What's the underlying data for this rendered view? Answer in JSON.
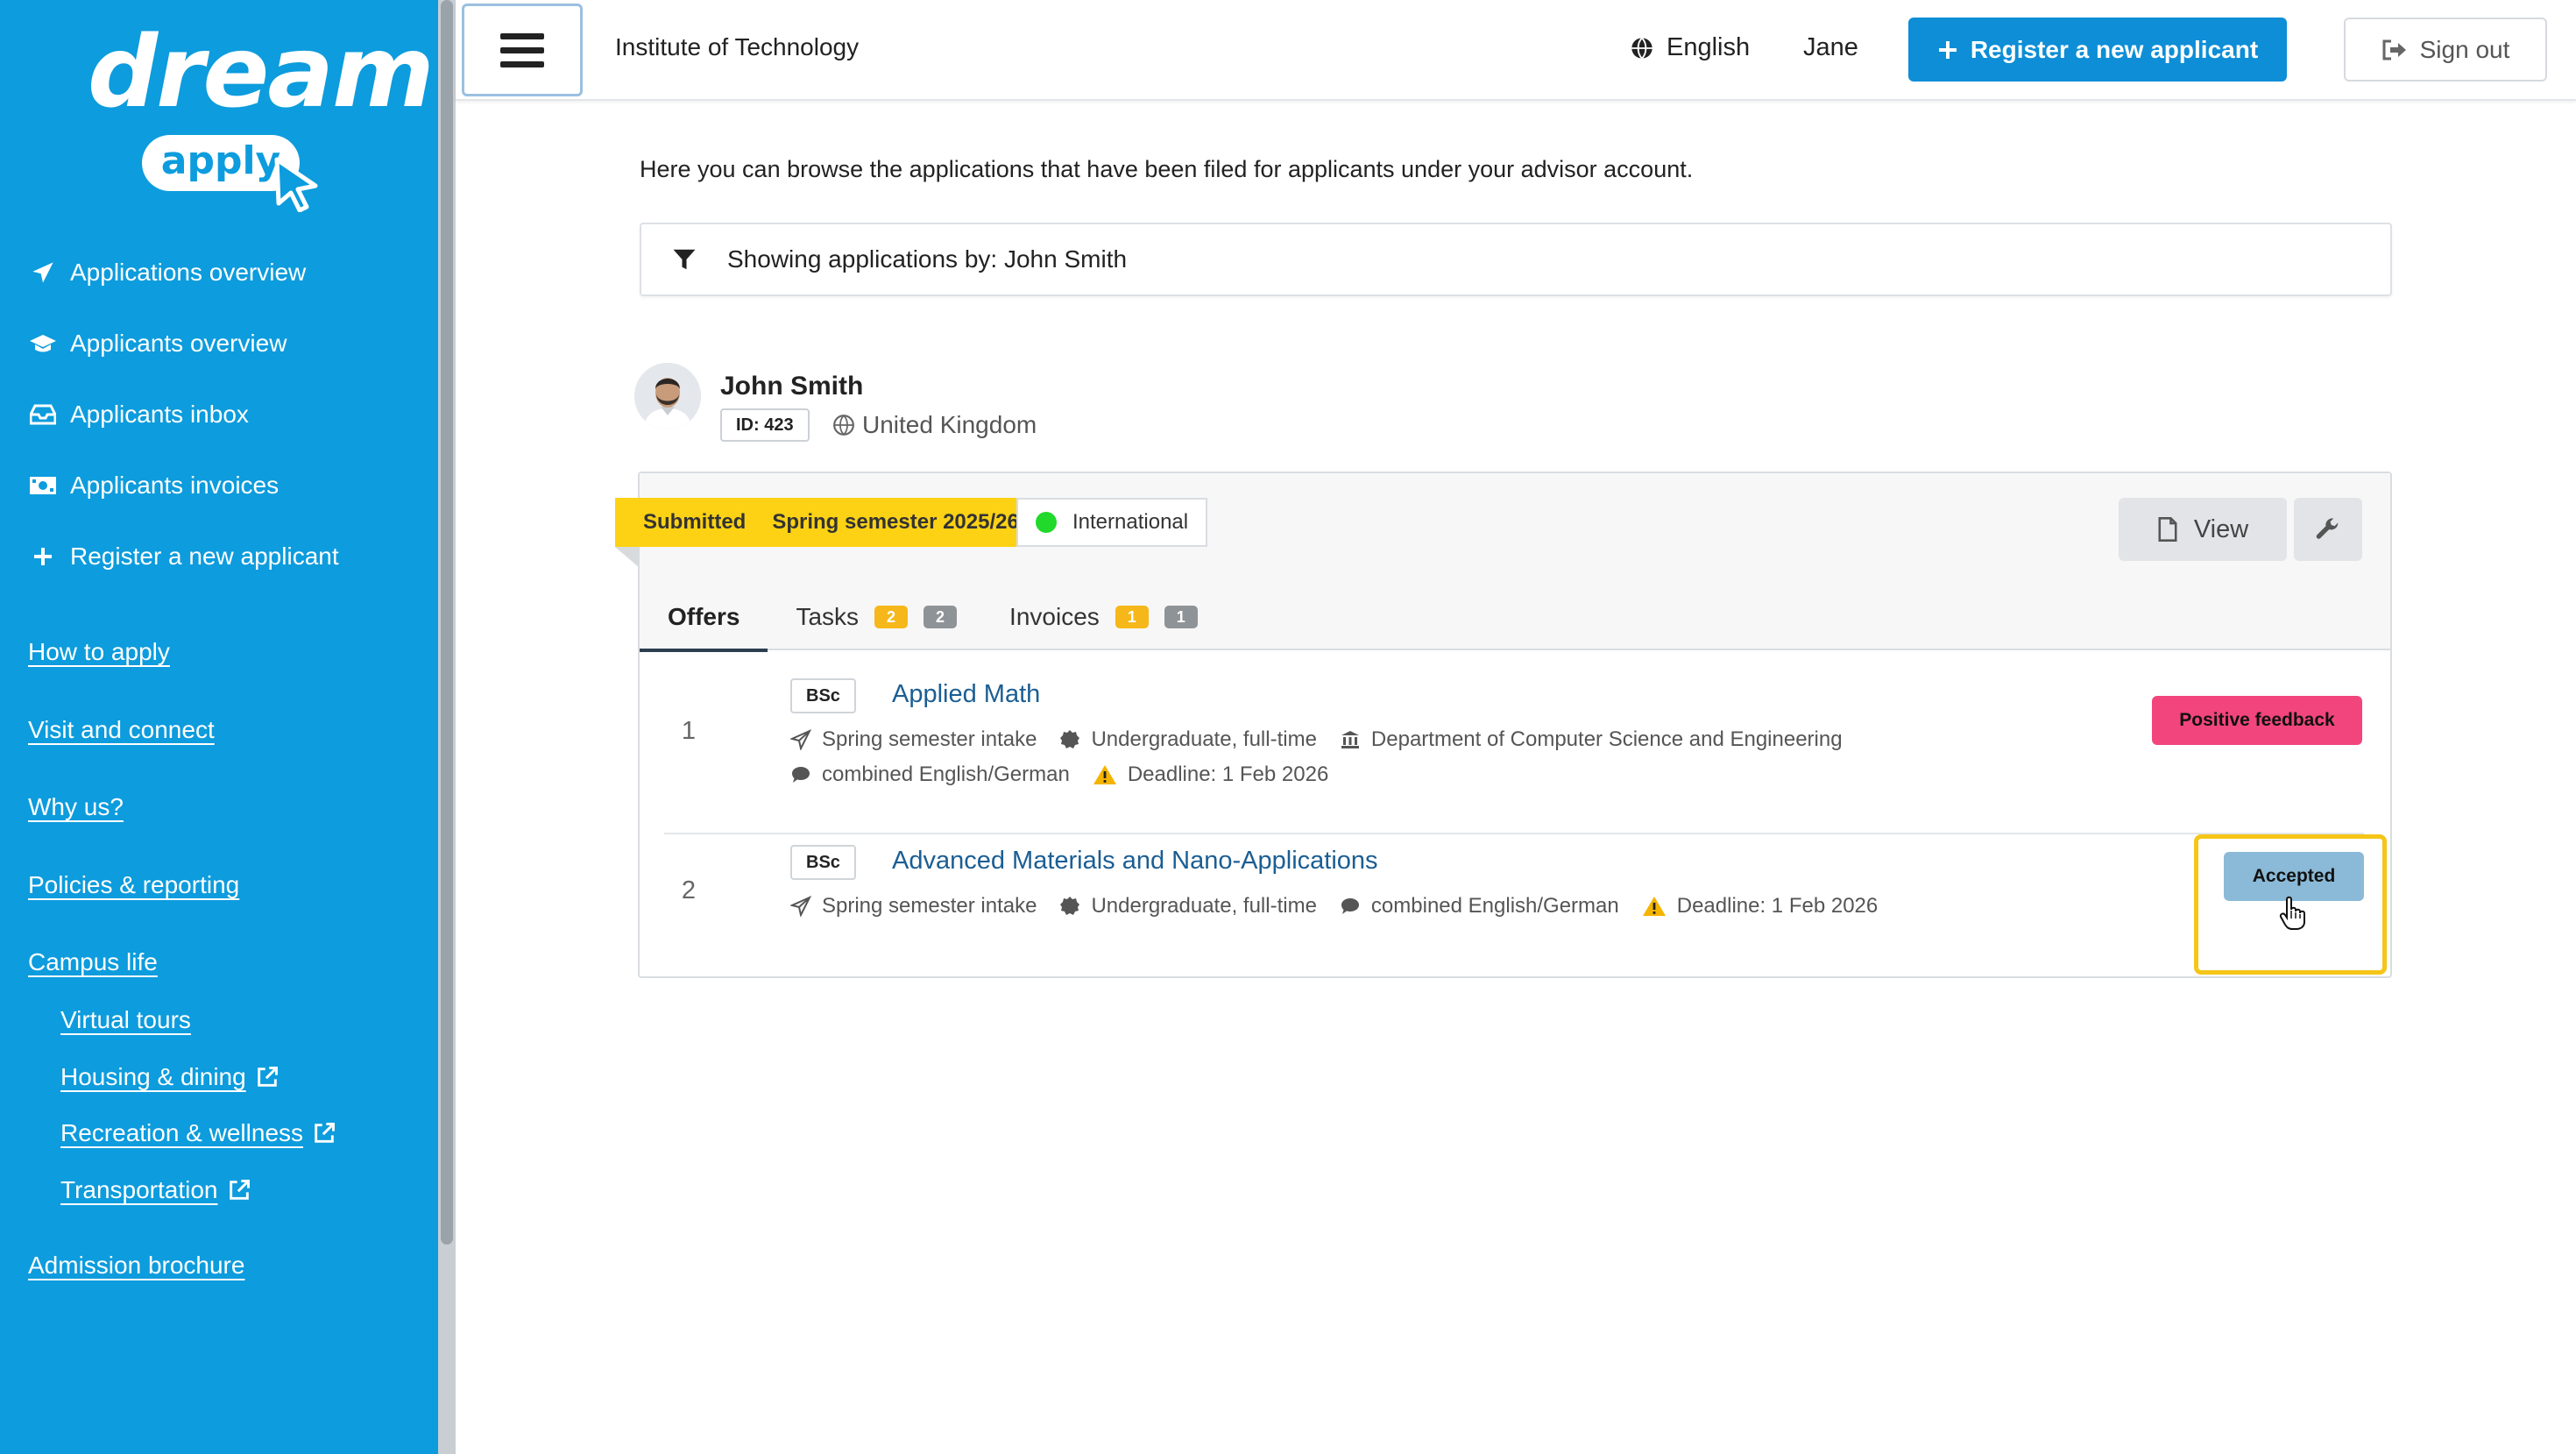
{
  "brand": {
    "word": "dream",
    "pill": "apply"
  },
  "sidebar": {
    "nav": [
      {
        "label": "Applications overview",
        "icon": "paper-plane-icon"
      },
      {
        "label": "Applicants overview",
        "icon": "graduation-cap-icon"
      },
      {
        "label": "Applicants inbox",
        "icon": "inbox-icon"
      },
      {
        "label": "Applicants invoices",
        "icon": "money-bill-icon"
      },
      {
        "label": "Register a new applicant",
        "icon": "plus-icon"
      }
    ],
    "links": [
      "How to apply",
      "Visit and connect",
      "Why us?",
      "Policies & reporting",
      "Campus life"
    ],
    "sublinks": [
      {
        "label": "Virtual tours",
        "external": false
      },
      {
        "label": "Housing & dining",
        "external": true
      },
      {
        "label": "Recreation & wellness",
        "external": true
      },
      {
        "label": "Transportation",
        "external": true
      }
    ],
    "brochure": "Admission brochure"
  },
  "header": {
    "institution": "Institute of Technology",
    "language": "English",
    "user": "Jane",
    "register_label": "Register a new applicant",
    "signout_label": "Sign out"
  },
  "main": {
    "intro": "Here you can browse the applications that have been filed for applicants under your advisor account.",
    "filter": "Showing applications by: John Smith"
  },
  "applicant": {
    "name": "John Smith",
    "id": "ID: 423",
    "country": "United Kingdom"
  },
  "application": {
    "status": "Submitted",
    "intake": "Spring semester 2025/26",
    "tag": "International",
    "tag_color": "#21d92b",
    "view_label": "View",
    "tabs": [
      {
        "label": "Offers",
        "active": true,
        "badges": []
      },
      {
        "label": "Tasks",
        "active": false,
        "badges": [
          "2",
          "2"
        ]
      },
      {
        "label": "Invoices",
        "active": false,
        "badges": [
          "1",
          "1"
        ]
      }
    ],
    "offers": [
      {
        "num": "1",
        "degree": "BSc",
        "program": "Applied Math",
        "intake": "Spring semester intake",
        "level": "Undergraduate, full-time",
        "department": "Department of Computer Science and Engineering",
        "language": "combined English/German",
        "deadline": "Deadline: 1 Feb 2026",
        "decision": "Positive feedback",
        "decision_color": "#f2457d"
      },
      {
        "num": "2",
        "degree": "BSc",
        "program": "Advanced Materials and Nano-Applications",
        "intake": "Spring semester intake",
        "level": "Undergraduate, full-time",
        "language": "combined English/German",
        "deadline": "Deadline: 1 Feb 2026",
        "decision": "Accepted",
        "decision_color": "#8bbad8"
      }
    ]
  }
}
